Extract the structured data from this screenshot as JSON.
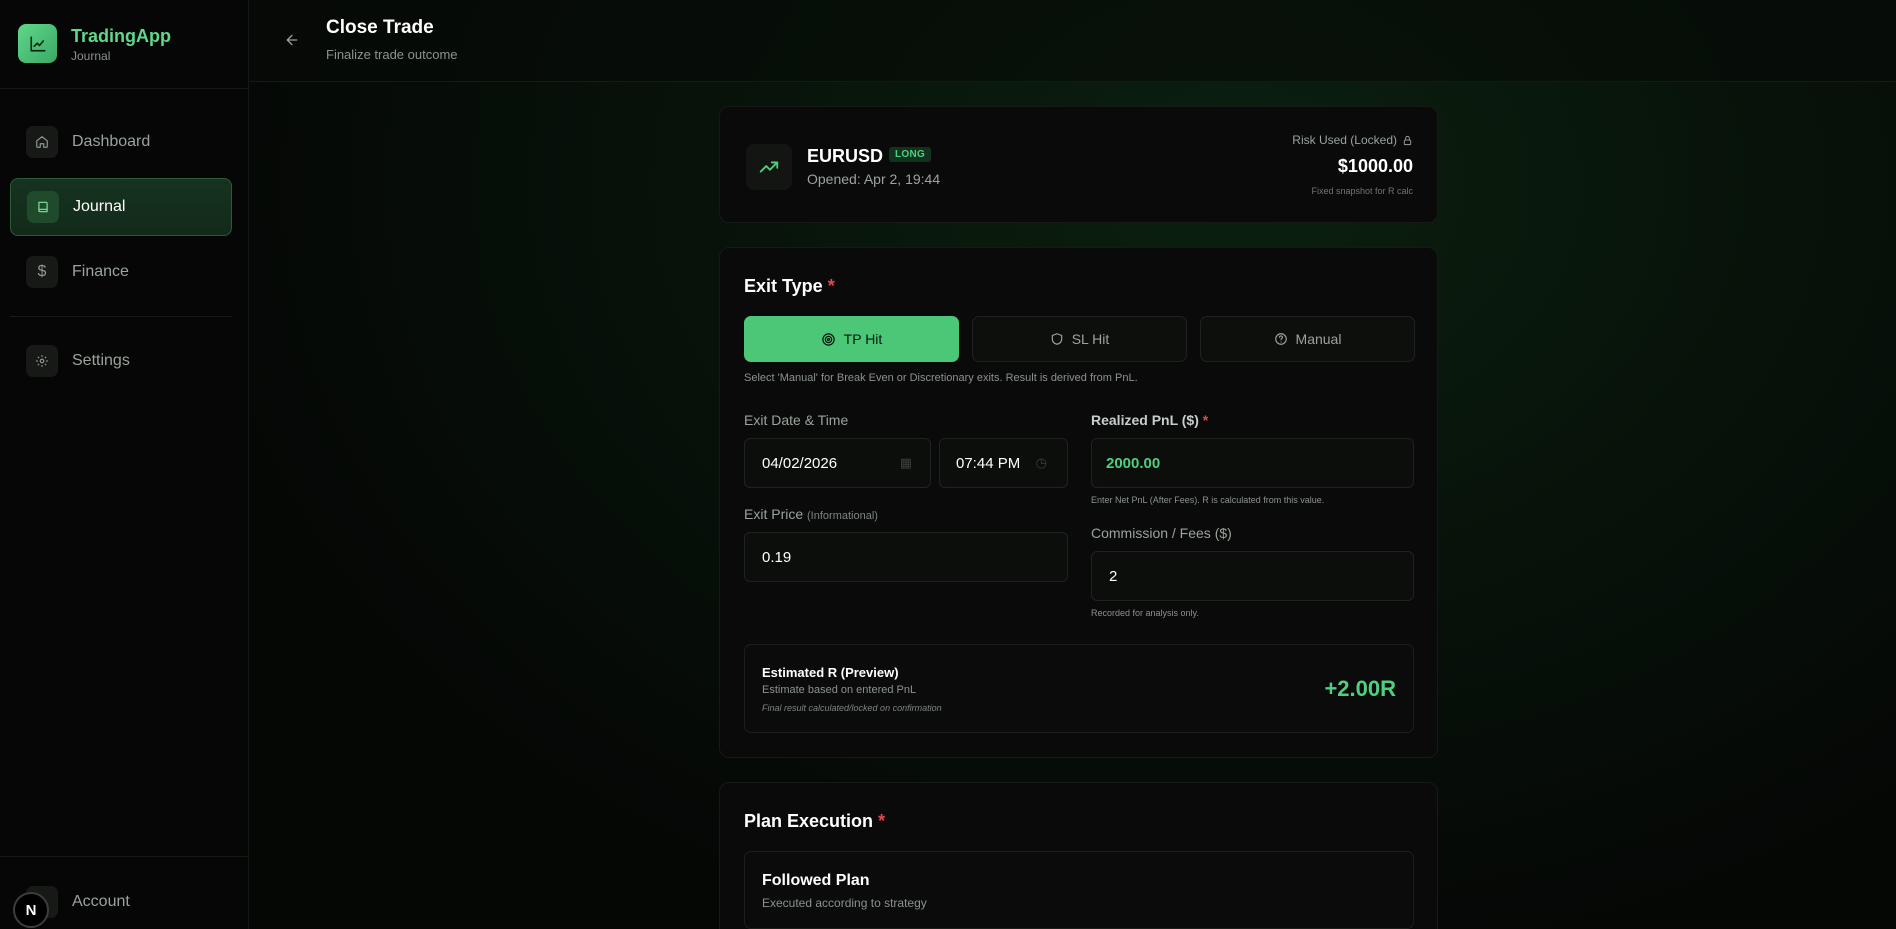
{
  "app": {
    "name": "TradingApp",
    "subtitle": "Journal"
  },
  "sidebar": {
    "items": [
      {
        "label": "Dashboard",
        "icon": "home-icon"
      },
      {
        "label": "Journal",
        "icon": "book-icon"
      },
      {
        "label": "Finance",
        "icon": "dollar-icon"
      },
      {
        "label": "Settings",
        "icon": "gear-icon"
      }
    ],
    "account_label": "Account",
    "badge_letter": "N"
  },
  "header": {
    "title": "Close Trade",
    "subtitle": "Finalize trade outcome"
  },
  "trade": {
    "pair": "EURUSD",
    "direction": "LONG",
    "opened": "Opened: Apr 2, 19:44",
    "risk_label": "Risk Used (Locked)",
    "risk_value": "$1000.00",
    "risk_note": "Fixed snapshot for R calc"
  },
  "exit": {
    "title": "Exit Type",
    "required_mark": "*",
    "types": [
      "TP Hit",
      "SL Hit",
      "Manual"
    ],
    "selected_type": "TP Hit",
    "hint": "Select 'Manual' for Break Even or Discretionary exits. Result is derived from PnL.",
    "date_label": "Exit Date & Time",
    "date_value": "04/02/2026",
    "time_value": "07:44 PM",
    "pnl_label": "Realized PnL ($)",
    "pnl_value": "2000.00",
    "pnl_hint": "Enter Net PnL (After Fees). R is calculated from this value.",
    "price_label": "Exit Price",
    "price_label_note": "(Informational)",
    "price_value": "0.19",
    "fees_label": "Commission / Fees ($)",
    "fees_value": "2",
    "fees_hint": "Recorded for analysis only."
  },
  "preview": {
    "title": "Estimated R (Preview)",
    "subtitle": "Estimate based on entered PnL",
    "note": "Final result calculated/locked on confirmation",
    "value": "+2.00R"
  },
  "plan": {
    "title": "Plan Execution",
    "required_mark": "*",
    "option_title": "Followed Plan",
    "option_sub": "Executed according to strategy"
  },
  "colors": {
    "accent": "#4cc777",
    "accent_text": "#5fd88a",
    "required": "#e5484d",
    "background": "#060806"
  }
}
